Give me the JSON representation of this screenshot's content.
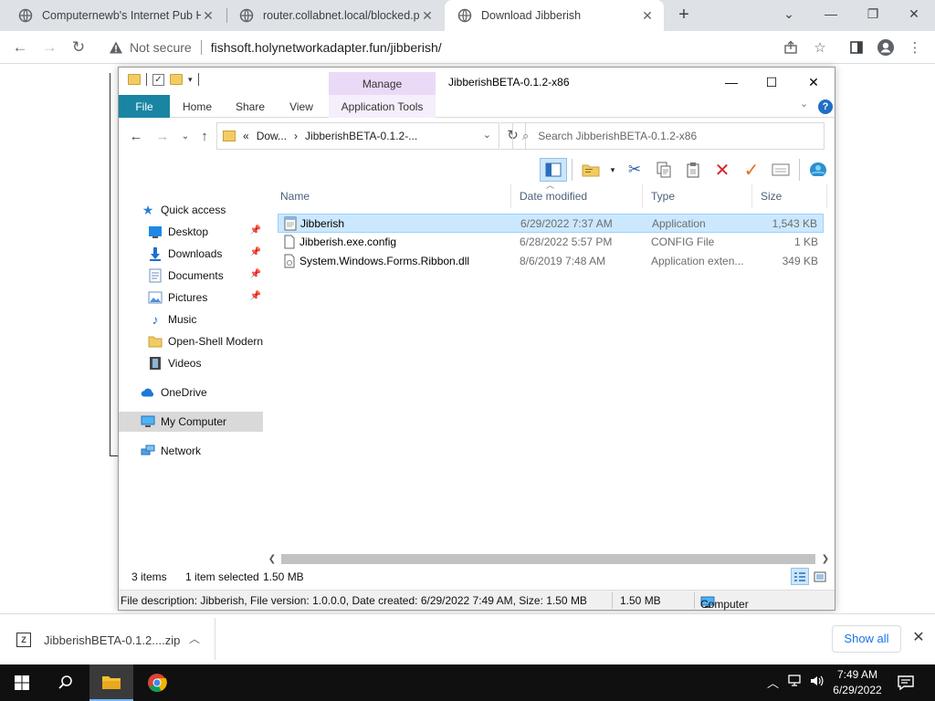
{
  "browser": {
    "tabs": [
      {
        "title": "Computernewb's Internet Pub H",
        "active": false
      },
      {
        "title": "router.collabnet.local/blocked.ph",
        "active": false
      },
      {
        "title": "Download Jibberish",
        "active": true
      }
    ],
    "not_secure_label": "Not secure",
    "url": "fishsoft.holynetworkadapter.fun/jibberish/"
  },
  "explorer": {
    "title": "JibberishBETA-0.1.2-x86",
    "ribbon": {
      "manage": "Manage",
      "file": "File",
      "home": "Home",
      "share": "Share",
      "view": "View",
      "application_tools": "Application Tools"
    },
    "address": {
      "chevrons": "«",
      "seg1": "Dow...",
      "seg_sep": "›",
      "seg2": "JibberishBETA-0.1.2-..."
    },
    "search_placeholder": "Search JibberishBETA-0.1.2-x86",
    "nav": {
      "quick_access": "Quick access",
      "desktop": "Desktop",
      "downloads": "Downloads",
      "documents": "Documents",
      "pictures": "Pictures",
      "music": "Music",
      "openshell": "Open-Shell Modern",
      "videos": "Videos",
      "onedrive": "OneDrive",
      "my_computer": "My Computer",
      "network": "Network"
    },
    "columns": {
      "name": "Name",
      "date": "Date modified",
      "type": "Type",
      "size": "Size"
    },
    "files": [
      {
        "name": "Jibberish",
        "date": "6/29/2022 7:37 AM",
        "type": "Application",
        "size": "1,543 KB",
        "icon": "application-icon"
      },
      {
        "name": "Jibberish.exe.config",
        "date": "6/28/2022 5:57 PM",
        "type": "CONFIG File",
        "size": "1 KB",
        "icon": "config-file-icon"
      },
      {
        "name": "System.Windows.Forms.Ribbon.dll",
        "date": "8/6/2019 7:48 AM",
        "type": "Application exten...",
        "size": "349 KB",
        "icon": "dll-file-icon"
      }
    ],
    "status": {
      "items": "3 items",
      "selected": "1 item selected",
      "selected_size": "1.50 MB"
    },
    "infobar": {
      "description": "File description: Jibberish, File version: 1.0.0.0, Date created: 6/29/2022 7:49 AM, Size: 1.50 MB",
      "size": "1.50 MB",
      "location": "Computer"
    }
  },
  "downloads": {
    "file": "JibberishBETA-0.1.2....zip",
    "show_all": "Show all"
  },
  "taskbar": {
    "time": "7:49 AM",
    "date": "6/29/2022"
  }
}
